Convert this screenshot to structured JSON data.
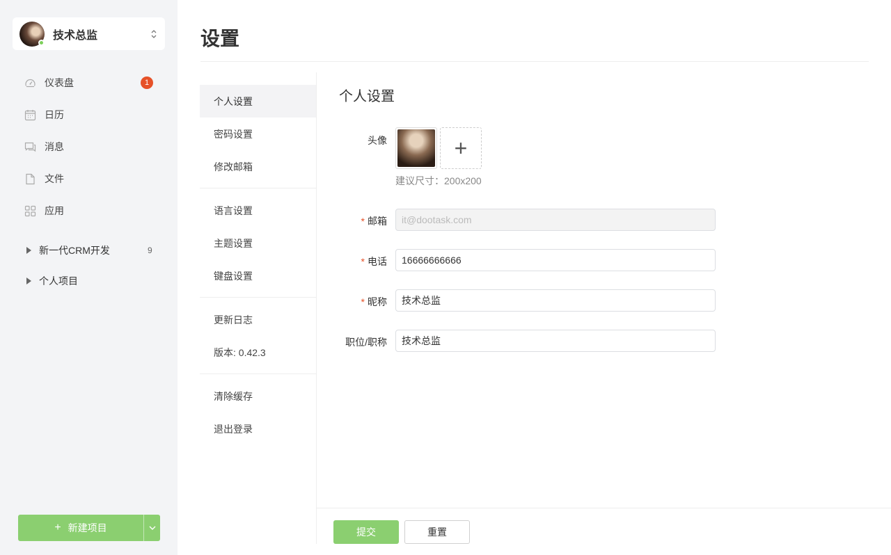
{
  "sidebar": {
    "user": {
      "name": "技术总监"
    },
    "nav": [
      {
        "label": "仪表盘",
        "icon": "dashboard-icon",
        "badge": "1"
      },
      {
        "label": "日历",
        "icon": "calendar-icon"
      },
      {
        "label": "消息",
        "icon": "message-icon"
      },
      {
        "label": "文件",
        "icon": "file-icon"
      },
      {
        "label": "应用",
        "icon": "apps-icon"
      }
    ],
    "projects": [
      {
        "label": "新一代CRM开发",
        "count": "9"
      },
      {
        "label": "个人项目"
      }
    ],
    "new_project": {
      "label": "新建项目",
      "plus": "+"
    }
  },
  "page": {
    "title": "设置"
  },
  "settings_menu": {
    "group1": [
      "个人设置",
      "密码设置",
      "修改邮箱"
    ],
    "group2": [
      "语言设置",
      "主题设置",
      "键盘设置"
    ],
    "group3": [
      "更新日志",
      "版本: 0.42.3"
    ],
    "group4": [
      "清除缓存",
      "退出登录"
    ]
  },
  "form": {
    "section_title": "个人设置",
    "avatar_label": "头像",
    "avatar_add": "+",
    "avatar_hint": "建议尺寸：200x200",
    "email_label": "邮箱",
    "email_placeholder": "it@dootask.com",
    "phone_label": "电话",
    "phone_value": "16666666666",
    "nickname_label": "昵称",
    "nickname_value": "技术总监",
    "position_label": "职位/职称",
    "position_value": "技术总监",
    "required_mark": "*",
    "submit_label": "提交",
    "reset_label": "重置"
  },
  "colors": {
    "accent_green": "#8bcf70",
    "badge_red": "#e65128",
    "online_green": "#7ccf5a",
    "sidebar_bg": "#f3f4f6"
  }
}
